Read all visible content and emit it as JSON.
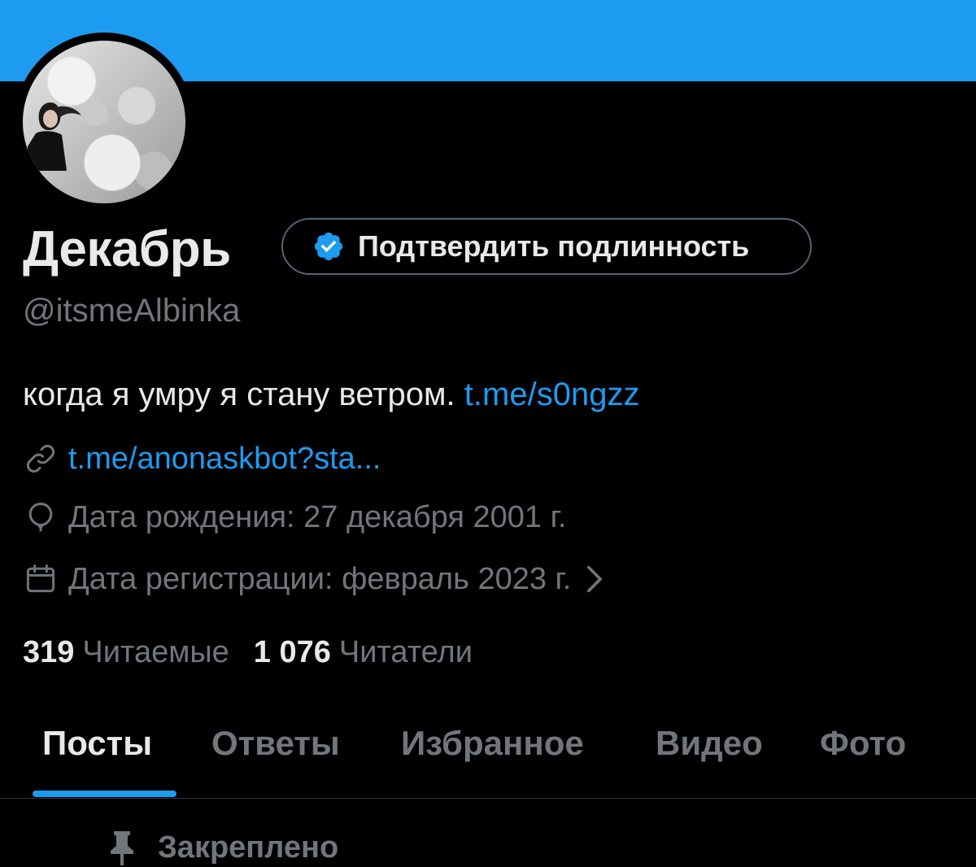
{
  "profile": {
    "display_name": "Декабрь",
    "handle": "@itsmeAlbinka",
    "verify_button_label": "Подтвердить подлинность",
    "bio_text": "когда я умру я стану ветром.",
    "bio_link": "t.me/s0ngzz",
    "website_link": "t.me/anonaskbot?sta...",
    "birthday": "Дата рождения: 27 декабря 2001 г.",
    "joined": "Дата регистрации: февраль 2023 г."
  },
  "stats": {
    "following_count": "319",
    "following_label": "Читаемые",
    "followers_count": "1 076",
    "followers_label": "Читатели"
  },
  "tabs": [
    {
      "label": "Посты",
      "active": true
    },
    {
      "label": "Ответы",
      "active": false
    },
    {
      "label": "Избранное",
      "active": false
    },
    {
      "label": "Видео",
      "active": false
    },
    {
      "label": "Фото",
      "active": false
    }
  ],
  "pinned_label": "Закреплено",
  "colors": {
    "accent": "#1d9bf0",
    "background": "#000000",
    "text_primary": "#e7e9ea",
    "text_secondary": "#71767b",
    "border": "#2f3336"
  },
  "icons": {
    "verified": "verified-badge-icon",
    "link": "link-icon",
    "birthday": "balloon-icon",
    "calendar": "calendar-icon",
    "chevron": "chevron-right-icon",
    "pin": "pin-icon"
  }
}
